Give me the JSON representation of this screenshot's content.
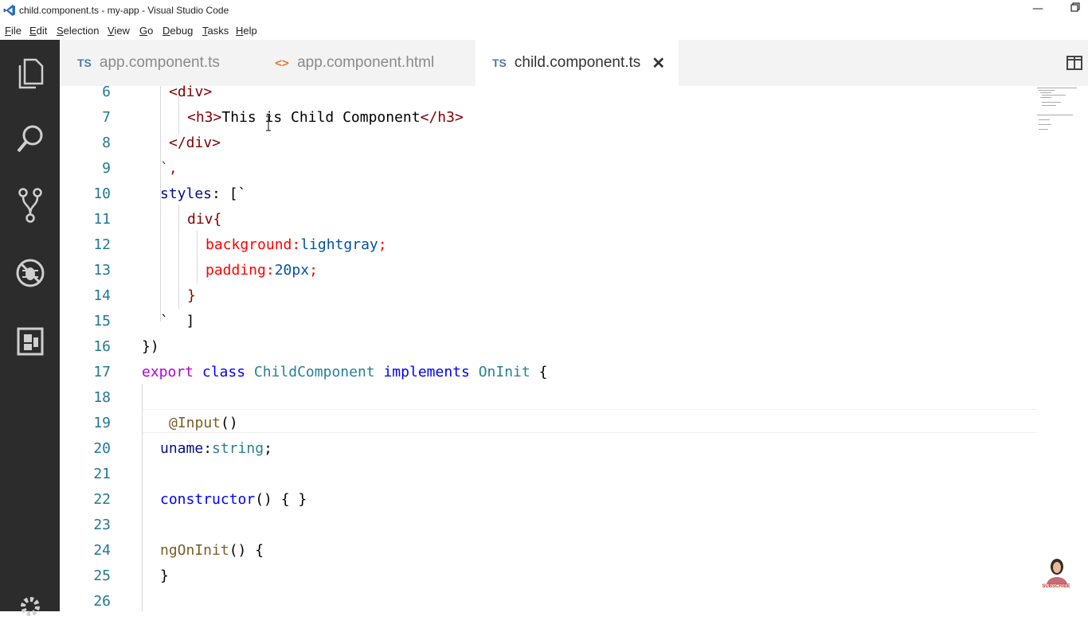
{
  "window": {
    "title": "child.component.ts - my-app - Visual Studio Code",
    "minimize_icon": "minimize-icon",
    "restore_icon": "restore-icon"
  },
  "menu": [
    "File",
    "Edit",
    "Selection",
    "View",
    "Go",
    "Debug",
    "Tasks",
    "Help"
  ],
  "activity_bar": {
    "icons": [
      "explorer-icon",
      "search-icon",
      "source-control-icon",
      "debug-icon",
      "extensions-icon",
      "settings-gear-icon"
    ]
  },
  "tabs": [
    {
      "label": "app.component.ts",
      "icon_text": "TS",
      "active": false
    },
    {
      "label": "app.component.html",
      "icon_text": "<>",
      "active": false
    },
    {
      "label": "child.component.ts",
      "icon_text": "TS",
      "active": true
    }
  ],
  "close_glyph": "✕",
  "editor": {
    "lines": [
      {
        "num": "6"
      },
      {
        "num": "7"
      },
      {
        "num": "8"
      },
      {
        "num": "9"
      },
      {
        "num": "10"
      },
      {
        "num": "11"
      },
      {
        "num": "12"
      },
      {
        "num": "13"
      },
      {
        "num": "14"
      },
      {
        "num": "15"
      },
      {
        "num": "16"
      },
      {
        "num": "17"
      },
      {
        "num": "18"
      },
      {
        "num": "19"
      },
      {
        "num": "20"
      },
      {
        "num": "21"
      },
      {
        "num": "22"
      },
      {
        "num": "23"
      },
      {
        "num": "24"
      },
      {
        "num": "25"
      },
      {
        "num": "26"
      }
    ],
    "code": {
      "l6_open": "<div>",
      "l7_open": "<h3>",
      "l7_text": "This is Child Component",
      "l7_close": "</h3>",
      "l8_close": "</div>",
      "l9": "`,",
      "l10_prop": "styles",
      "l10_rest": ": [`",
      "l11_sel": "div",
      "l11_brace": "{",
      "l12_prop": "background",
      "l12_colon": ":",
      "l12_val": "lightgray",
      "l12_semi": ";",
      "l13_prop": "padding",
      "l13_colon": ":",
      "l13_val": "20px",
      "l13_semi": ";",
      "l14": "}",
      "l15": "`  ]",
      "l16": "})",
      "l17_export": "export",
      "l17_class": "class",
      "l17_name": "ChildComponent",
      "l17_impl": "implements",
      "l17_iface": "OnInit",
      "l17_brace": "{",
      "l19_dec": "@Input",
      "l19_paren": "()",
      "l20_prop": "uname",
      "l20_colon": ":",
      "l20_type": "string",
      "l20_semi": ";",
      "l22_kw": "constructor",
      "l22_rest": "() { }",
      "l24_fn": "ngOnInit",
      "l24_rest": "() {",
      "l25": "}"
    }
  },
  "watermark": {
    "label": "SUBSCRIBE"
  }
}
